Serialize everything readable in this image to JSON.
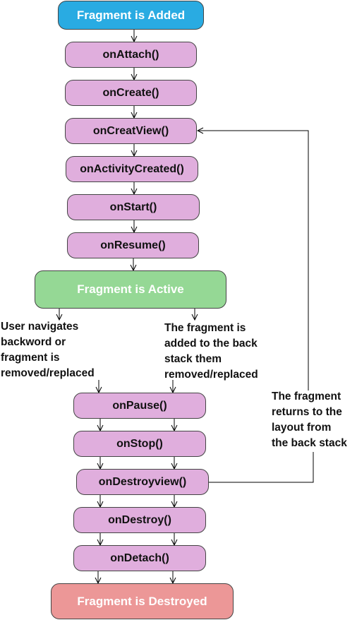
{
  "states": {
    "added": {
      "label": "Fragment  is Added",
      "color": "#29ABE2"
    },
    "active": {
      "label": "Fragment  is  Active",
      "color": "#95D895"
    },
    "destroyed": {
      "label": "Fragment  is  Destroyed",
      "color": "#EC9797"
    }
  },
  "callbacks": {
    "attach": "onAttach()",
    "create": "onCreate()",
    "create_view": "onCreatView()",
    "activity_created": "onActivityCreated()",
    "start": "onStart()",
    "resume": "onResume()",
    "pause": "onPause()",
    "stop": "onStop()",
    "destroy_view": "onDestroyview()",
    "destroy": "onDestroy()",
    "detach": "onDetach()"
  },
  "callback_color": "#E0AEDD",
  "notes": {
    "left_branch": "User navigates\nbackword or\nfragment is\nremoved/replaced",
    "right_branch": "The fragment is\nadded to the back\nstack them\nremoved/replaced",
    "loop_back": "The fragment\nreturns to the\nlayout from\nthe back stack"
  }
}
